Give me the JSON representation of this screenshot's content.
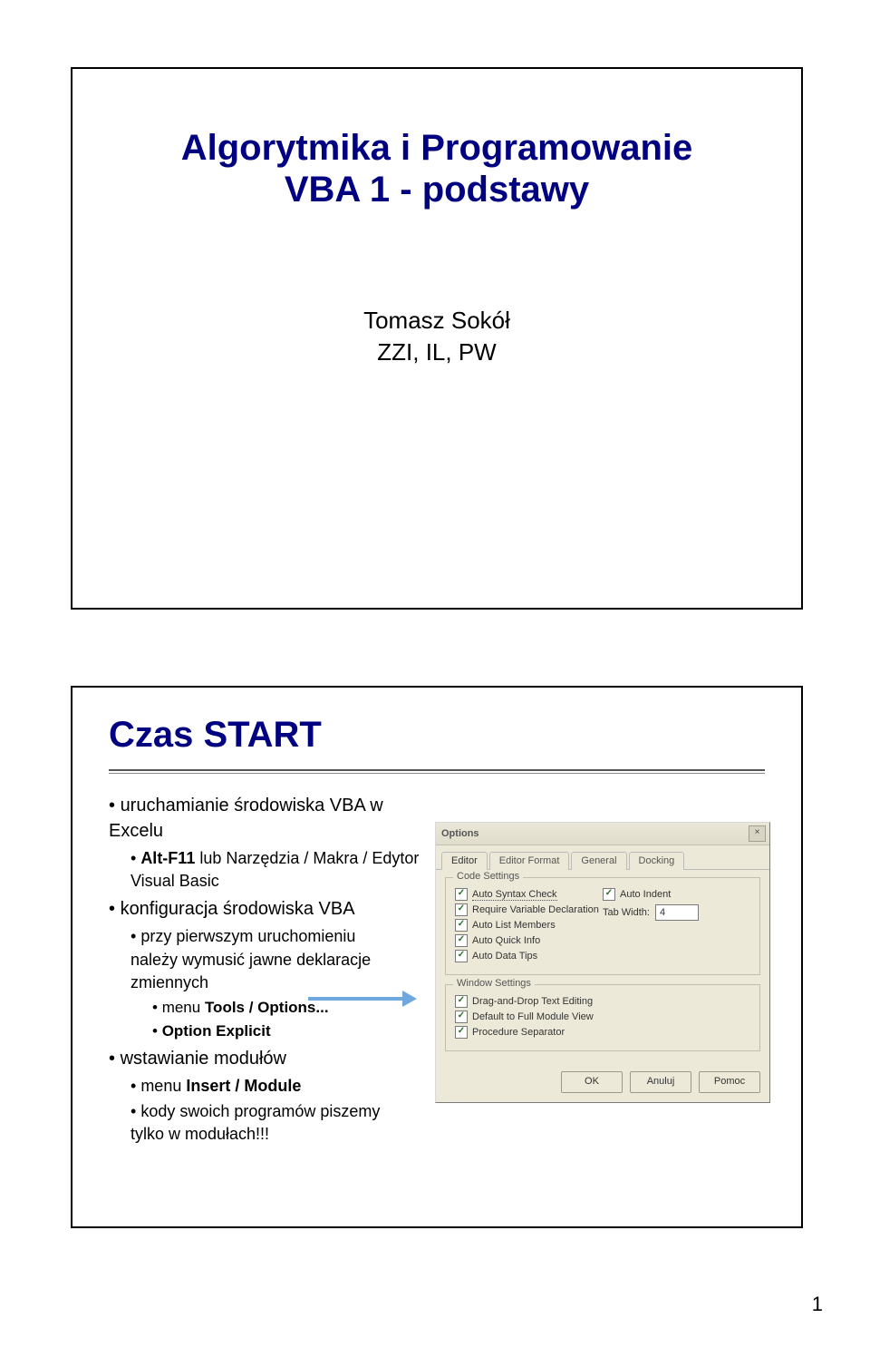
{
  "slide1": {
    "title_line1": "Algorytmika i Programowanie",
    "title_line2": "VBA 1 - podstawy",
    "author_line1": "Tomasz Sokół",
    "author_line2": "ZZI, IL, PW"
  },
  "slide2": {
    "title": "Czas START",
    "bullets": {
      "b1": "uruchamianie środowiska VBA w Excelu",
      "b1a_prefix": "Alt-F11",
      "b1a_rest": " lub Narzędzia / Makra / Edytor Visual Basic",
      "b2": "konfiguracja środowiska VBA",
      "b2a": "przy pierwszym uruchomieniu należy wymusić jawne deklaracje zmiennych",
      "b2a1_prefix": "menu ",
      "b2a1_bold": "Tools / Options...",
      "b2a2_bold": "Option Explicit",
      "b3": "wstawianie modułów",
      "b3a_prefix": "menu ",
      "b3a_bold": "Insert / Module",
      "b3b": "kody swoich programów piszemy tylko w modułach!!!"
    }
  },
  "dialog": {
    "title": "Options",
    "close": "×",
    "tabs": [
      "Editor",
      "Editor Format",
      "General",
      "Docking"
    ],
    "code_settings_legend": "Code Settings",
    "window_settings_legend": "Window Settings",
    "checks_left": [
      {
        "label": "Auto Syntax Check",
        "checked": true,
        "underline": true
      },
      {
        "label": "Require Variable Declaration",
        "checked": true
      },
      {
        "label": "Auto List Members",
        "checked": true
      },
      {
        "label": "Auto Quick Info",
        "checked": true
      },
      {
        "label": "Auto Data Tips",
        "checked": true
      }
    ],
    "checks_right": [
      {
        "label": "Auto Indent",
        "checked": true
      }
    ],
    "tab_width_label": "Tab Width:",
    "tab_width_value": "4",
    "window_checks": [
      {
        "label": "Drag-and-Drop Text Editing",
        "checked": true
      },
      {
        "label": "Default to Full Module View",
        "checked": true
      },
      {
        "label": "Procedure Separator",
        "checked": true
      }
    ],
    "buttons": [
      "OK",
      "Anuluj",
      "Pomoc"
    ]
  },
  "page_number": "1"
}
